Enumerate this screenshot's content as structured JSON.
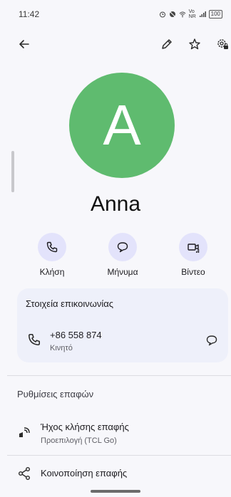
{
  "status_bar": {
    "time": "11:42",
    "network_label": "Vo NR",
    "battery": "100"
  },
  "toolbar": {
    "back": "back",
    "edit": "edit",
    "favorite": "favorite",
    "settings": "contact settings"
  },
  "contact": {
    "initial": "A",
    "name": "Anna",
    "avatar_color": "#5fbb6f"
  },
  "actions": [
    {
      "label": "Κλήση",
      "icon": "phone-icon"
    },
    {
      "label": "Μήνυμα",
      "icon": "message-icon"
    },
    {
      "label": "Βίντεο",
      "icon": "video-icon"
    }
  ],
  "contact_info": {
    "title": "Στοιχεία επικοινωνίας",
    "phone": "+86 558 874",
    "phone_type": "Κινητό"
  },
  "settings": {
    "title": "Ρυθμίσεις επαφών",
    "ringtone_label": "Ήχος κλήσης επαφής",
    "ringtone_value": "Προεπιλογή (TCL Go)",
    "share_label": "Κοινοποίηση επαφής"
  },
  "colors": {
    "accent_circle": "#e3e3fb",
    "card_bg": "#eef0fa",
    "background": "#f7f7fb"
  }
}
